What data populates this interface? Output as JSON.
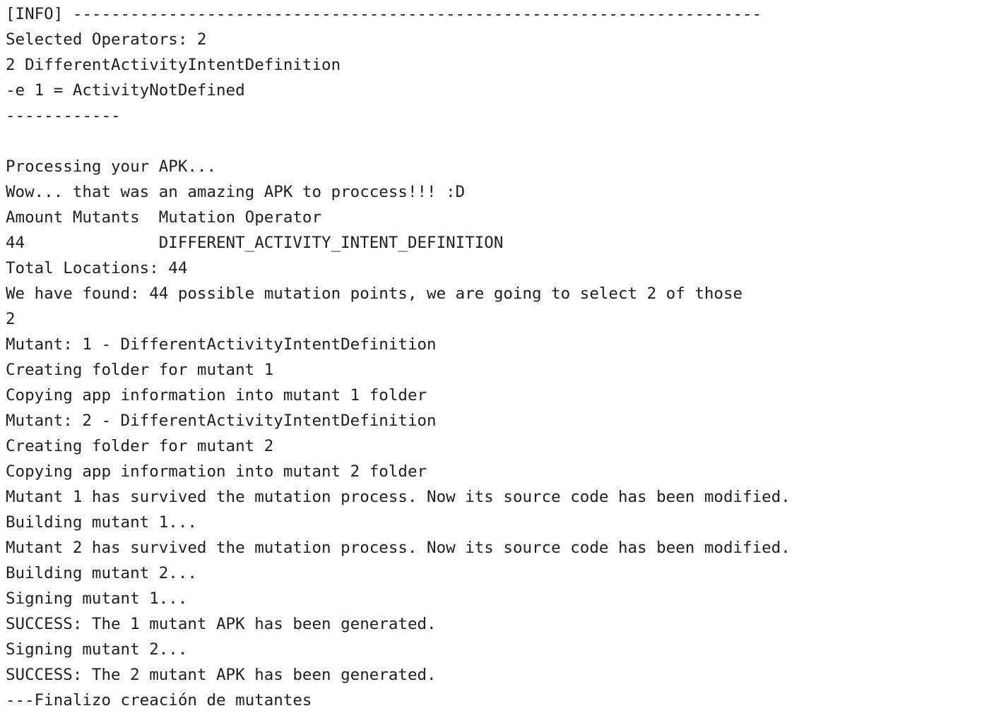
{
  "console": {
    "lines": [
      "[INFO] ------------------------------------------------------------------------",
      "Selected Operators: 2",
      "2 DifferentActivityIntentDefinition",
      "-e 1 = ActivityNotDefined",
      "------------",
      "",
      "Processing your APK...",
      "Wow... that was an amazing APK to proccess!!! :D",
      "Amount Mutants  Mutation Operator",
      "44              DIFFERENT_ACTIVITY_INTENT_DEFINITION",
      "Total Locations: 44",
      "We have found: 44 possible mutation points, we are going to select 2 of those",
      "2",
      "Mutant: 1 - DifferentActivityIntentDefinition",
      "Creating folder for mutant 1",
      "Copying app information into mutant 1 folder",
      "Mutant: 2 - DifferentActivityIntentDefinition",
      "Creating folder for mutant 2",
      "Copying app information into mutant 2 folder",
      "Mutant 1 has survived the mutation process. Now its source code has been modified.",
      "Building mutant 1...",
      "Mutant 2 has survived the mutation process. Now its source code has been modified.",
      "Building mutant 2...",
      "Signing mutant 1...",
      "SUCCESS: The 1 mutant APK has been generated.",
      "Signing mutant 2...",
      "SUCCESS: The 2 mutant APK has been generated.",
      "---Finalizo creación de mutantes"
    ]
  }
}
